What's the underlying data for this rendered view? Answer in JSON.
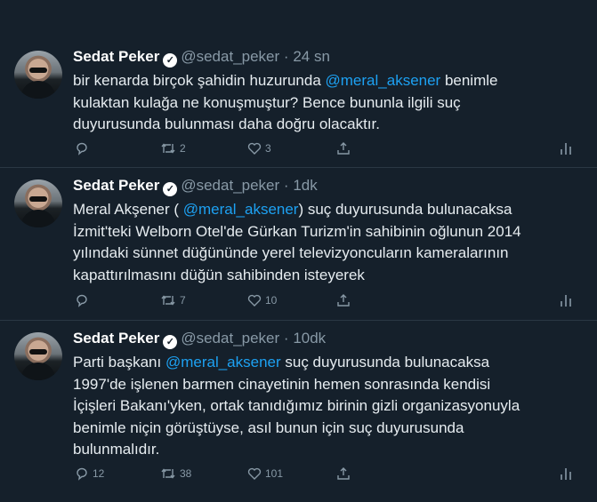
{
  "tweets": [
    {
      "name": "Sedat Peker",
      "handle": "@sedat_peker",
      "sep": "·",
      "time": "24 sn",
      "text_parts": [
        "bir kenarda birçok şahidin huzurunda ",
        "@meral_aksener",
        " benimle\nkulaktan kulağa ne konuşmuştur? Bence bununla ilgili suç\nduyurusunda bulunması daha doğru olacaktır."
      ],
      "replies": "",
      "retweets": "2",
      "likes": "3"
    },
    {
      "name": "Sedat Peker",
      "handle": "@sedat_peker",
      "sep": "·",
      "time": "1dk",
      "text_parts": [
        "Meral Akşener ( ",
        "@meral_aksener",
        ")  suç duyurusunda bulunacaksa\nİzmit'teki Welborn Otel'de Gürkan Turizm'in sahibinin oğlunun 2014\nyılındaki sünnet düğününde yerel televizyoncuların  kameralarının\nkapattırılmasını düğün sahibinden isteyerek"
      ],
      "replies": "",
      "retweets": "7",
      "likes": "10"
    },
    {
      "name": "Sedat Peker",
      "handle": "@sedat_peker",
      "sep": "·",
      "time": "10dk",
      "text_parts": [
        "Parti başkanı ",
        "@meral_aksener",
        "  suç duyurusunda bulunacaksa\n1997'de işlenen barmen cinayetinin hemen sonrasında kendisi\nİçişleri Bakanı'yken, ortak tanıdığımız birinin gizli organizasyonuyla\nbenimle niçin görüştüyse, asıl bunun için suç duyurusunda\nbulunmalıdır."
      ],
      "replies": "12",
      "retweets": "38",
      "likes": "101"
    }
  ],
  "icons": {
    "reply": "reply-icon",
    "retweet": "retweet-icon",
    "like": "heart-icon",
    "share": "share-icon",
    "analytics": "analytics-icon"
  },
  "colors": {
    "background": "#15202b",
    "mention": "#1da1f2",
    "muted": "#8899a6"
  }
}
